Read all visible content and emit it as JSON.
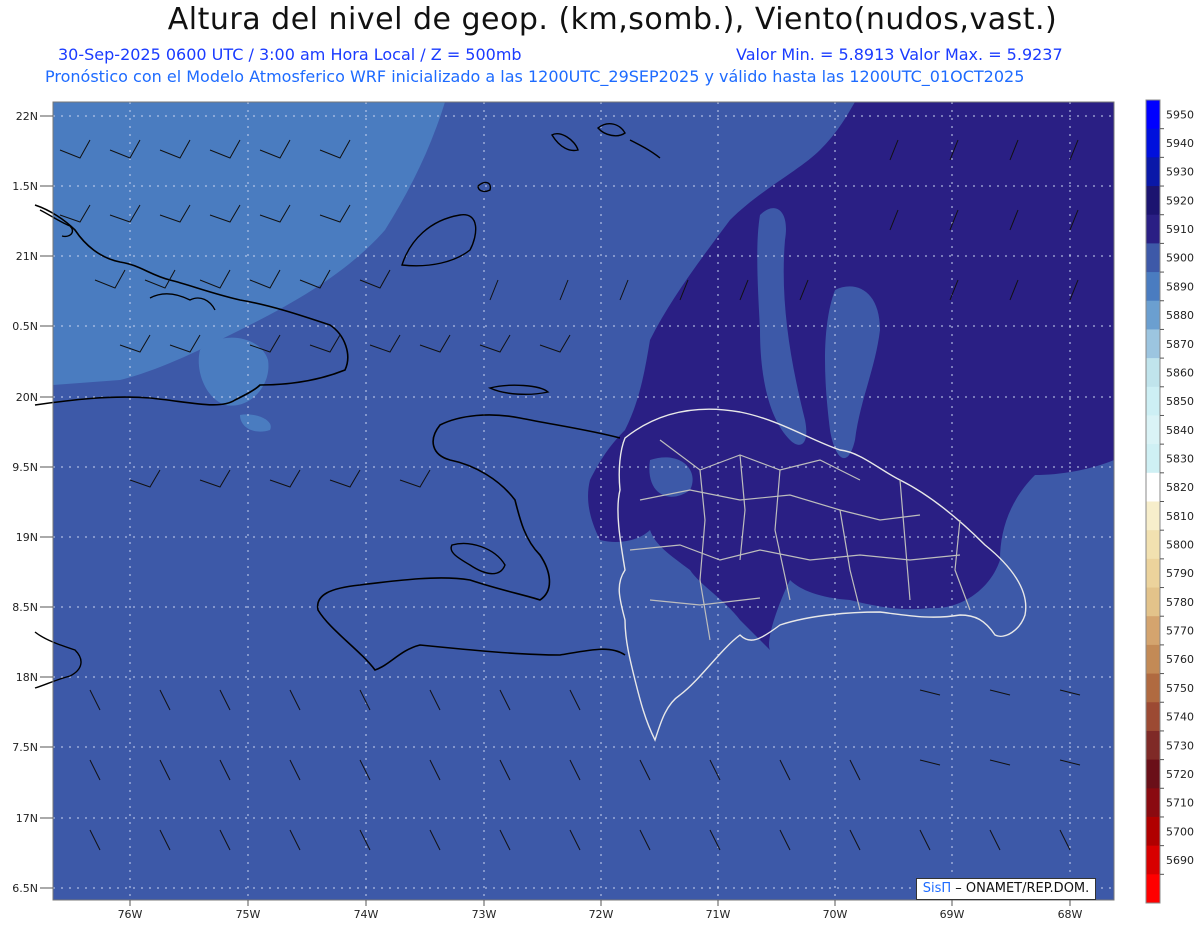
{
  "title": "Altura del nivel de geop. (km,somb.), Viento(nudos,vast.)",
  "subtitle_left": "30-Sep-2025  0600 UTC / 3:00 am Hora Local / Z = 500mb",
  "subtitle_right": "Valor Min. = 5.8913  Valor Max. = 5.9237",
  "subtitle_line2": "Pronóstico con el Modelo Atmosferico WRF inicializado a las 1200UTC_29SEP2025 y válido hasta las  1200UTC_01OCT2025",
  "credit": {
    "brand": "SisΠ",
    "text": " – ONAMET/REP.DOM."
  },
  "lat_labels": [
    "22N",
    "1.5N",
    "21N",
    "0.5N",
    "20N",
    "9.5N",
    "19N",
    "8.5N",
    "18N",
    "7.5N",
    "17N",
    "6.5N"
  ],
  "lon_labels": [
    "76W",
    "75W",
    "74W",
    "73W",
    "72W",
    "71W",
    "70W",
    "69W",
    "68W"
  ],
  "colorbar": {
    "levels": [
      "5950",
      "5940",
      "5930",
      "5920",
      "5910",
      "5900",
      "5890",
      "5880",
      "5870",
      "5860",
      "5850",
      "5840",
      "5830",
      "5820",
      "5810",
      "5800",
      "5790",
      "5780",
      "5770",
      "5760",
      "5750",
      "5740",
      "5730",
      "5720",
      "5710",
      "5700",
      "5690"
    ],
    "colors": [
      "#0000ff",
      "#0010dd",
      "#0a18a8",
      "#1c1470",
      "#2a1f84",
      "#3d59a8",
      "#4a7cc0",
      "#6b9fd0",
      "#9cc5e0",
      "#c0e4ec",
      "#cdeff4",
      "#daf3f6",
      "#cff0f4",
      "#ffffff",
      "#f7eecb",
      "#f2e1b0",
      "#ecd39c",
      "#e3c38a",
      "#d4a46e",
      "#c38a56",
      "#b06a40",
      "#9c4a33",
      "#7f2a27",
      "#6a0f18",
      "#8a0a10",
      "#b00000",
      "#d80000",
      "#ff0000"
    ]
  },
  "colors": {
    "ocean_base": "#3d59a8",
    "low_height": "#4a7cc0",
    "high_height": "#2a1f84"
  }
}
